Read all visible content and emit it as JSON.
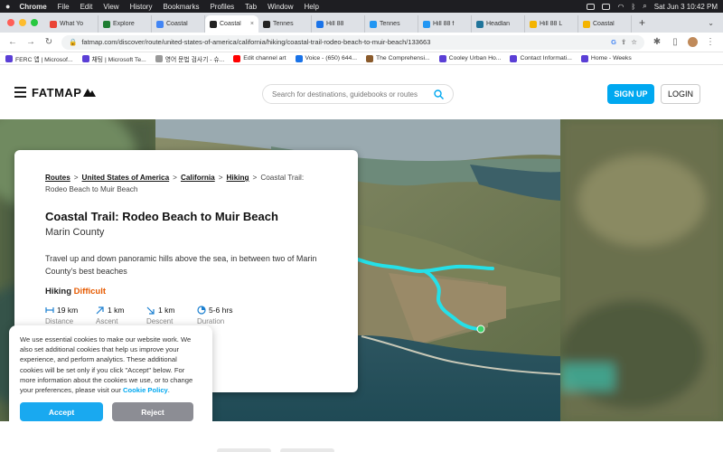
{
  "menubar": {
    "apple": "",
    "app": "Chrome",
    "items": [
      "File",
      "Edit",
      "View",
      "History",
      "Bookmarks",
      "Profiles",
      "Tab",
      "Window",
      "Help"
    ],
    "datetime": "Sat Jun 3  10:42 PM"
  },
  "tabs": [
    {
      "label": "What Yo",
      "color": "#ea4335"
    },
    {
      "label": "Explore",
      "color": "#1e7d32"
    },
    {
      "label": "Coastal",
      "color": "#4285f4"
    },
    {
      "label": "Coastal",
      "color": "#222222",
      "active": true
    },
    {
      "label": "Tennes",
      "color": "#222222"
    },
    {
      "label": "Hill 88",
      "color": "#1a73e8"
    },
    {
      "label": "Tennes",
      "color": "#2196f3"
    },
    {
      "label": "Hill 88 f",
      "color": "#2196f3"
    },
    {
      "label": "Headlan",
      "color": "#21759b"
    },
    {
      "label": "Hill 88 L",
      "color": "#f4b400"
    },
    {
      "label": "Coastal",
      "color": "#f4b400"
    }
  ],
  "address": {
    "url": "fatmap.com/discover/route/united-states-of-america/california/hiking/coastal-trail-rodeo-beach-to-muir-beach/133663"
  },
  "bookmarks": [
    {
      "label": "FERC 앱 | Microsof...",
      "color": "#5b3fd6"
    },
    {
      "label": "채팅 | Microsoft Te...",
      "color": "#5b3fd6"
    },
    {
      "label": "영어 문법 검사기 - 슈...",
      "color": "#999999"
    },
    {
      "label": "Edit channel art",
      "color": "#ff0000"
    },
    {
      "label": "Voice - (650) 644...",
      "color": "#1a73e8"
    },
    {
      "label": "The Comprehensi...",
      "color": "#8a5a2b"
    },
    {
      "label": "Cooley Urban Ho...",
      "color": "#5b3fd6"
    },
    {
      "label": "Contact Informati...",
      "color": "#5b3fd6"
    },
    {
      "label": "Home - Weeks",
      "color": "#5b3fd6"
    }
  ],
  "site": {
    "logo": "FATMAP",
    "search_placeholder": "Search for destinations, guidebooks or routes",
    "signup": "SIGN UP",
    "login": "LOGIN"
  },
  "route": {
    "breadcrumbs": [
      "Routes",
      "United States of America",
      "California",
      "Hiking"
    ],
    "breadcrumb_current": "Coastal Trail: Rodeo Beach to Muir Beach",
    "title": "Coastal Trail: Rodeo Beach to Muir Beach",
    "region": "Marin County",
    "description": "Travel up and down panoramic hills above the sea, in between two of Marin County's best beaches",
    "activity": "Hiking",
    "difficulty": "Difficult",
    "stats": [
      {
        "value": "19 km",
        "label": "Distance",
        "icon": "distance-icon"
      },
      {
        "value": "1 km",
        "label": "Ascent",
        "icon": "ascent-icon"
      },
      {
        "value": "1 km",
        "label": "Descent",
        "icon": "descent-icon"
      },
      {
        "value": "5-6 hrs",
        "label": "Duration",
        "icon": "clock-icon"
      }
    ]
  },
  "cookie": {
    "text": "We use essential cookies to make our website work. We also set additional cookies that help us improve your experience, and perform analytics. These additional cookies will be set only if you click \"Accept\" below. For more information about the cookies we use, or to change your preferences, please visit our ",
    "link": "Cookie Policy",
    "link_suffix": ".",
    "accept": "Accept",
    "reject": "Reject"
  },
  "colors": {
    "accent": "#00a8f0",
    "difficulty": "#e65a00",
    "trail": "#25e0e8"
  }
}
